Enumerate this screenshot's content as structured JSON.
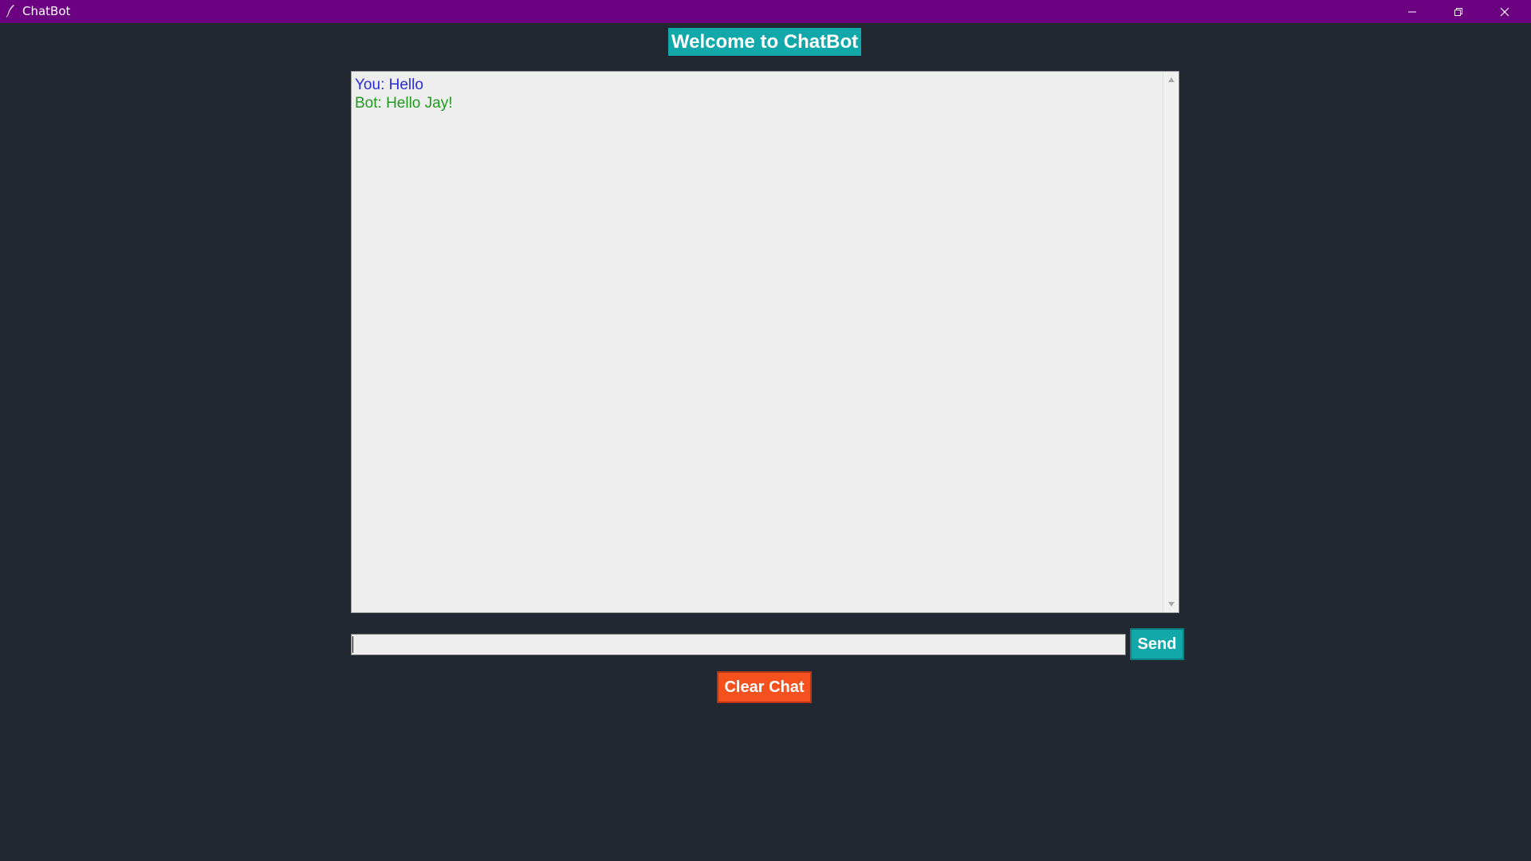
{
  "window": {
    "title": "ChatBot",
    "titlebar_color": "#6b0080",
    "background_color": "#222831",
    "controls": {
      "minimize_icon": "minimize-icon",
      "maximize_icon": "restore-icon",
      "close_icon": "close-icon"
    }
  },
  "header": {
    "title": "Welcome to ChatBot",
    "accent": "#12a8aa"
  },
  "chat": {
    "messages": [
      {
        "sender": "user",
        "text": "You: Hello",
        "color": "#2b2bd6"
      },
      {
        "sender": "bot",
        "text": "Bot: Hello Jay!",
        "color": "#1f9b1f"
      }
    ],
    "scrollbar": {
      "up_icon": "scroll-up-arrow-icon",
      "down_icon": "scroll-down-arrow-icon"
    }
  },
  "input": {
    "value": "",
    "placeholder": ""
  },
  "buttons": {
    "send_label": "Send",
    "send_color": "#12a8aa",
    "clear_label": "Clear Chat",
    "clear_color": "#f4511e"
  }
}
